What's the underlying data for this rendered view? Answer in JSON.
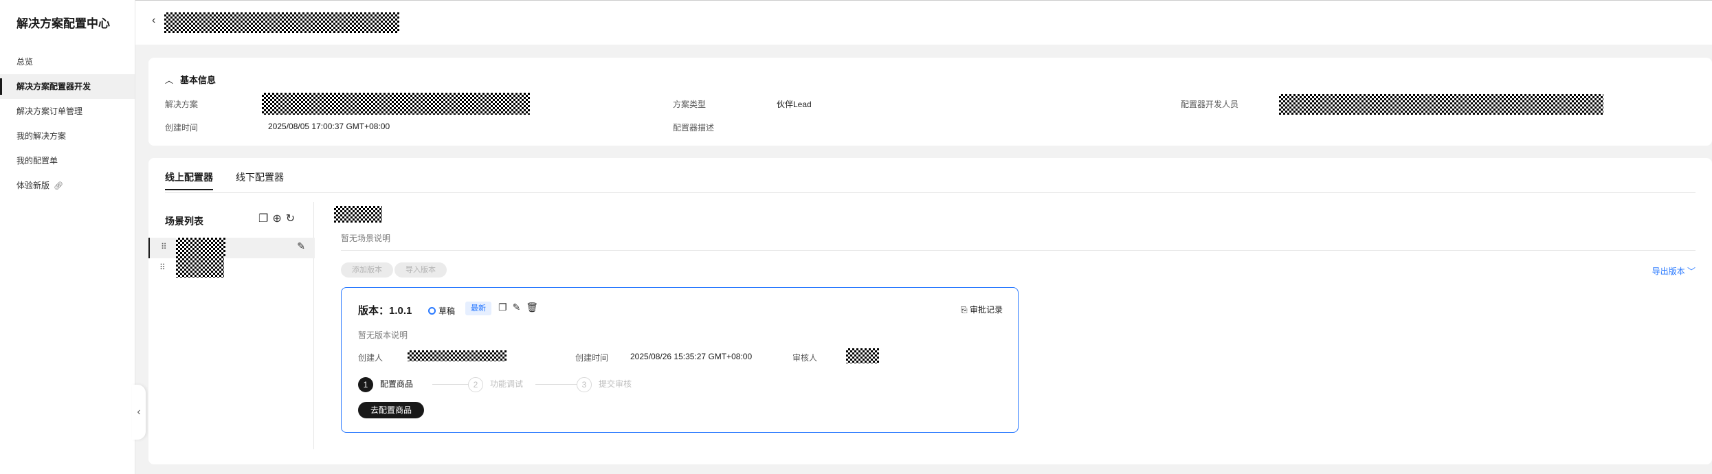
{
  "sidebar": {
    "brand": "解决方案配置中心",
    "items": [
      {
        "label": "总览"
      },
      {
        "label": "解决方案配置器开发"
      },
      {
        "label": "解决方案订单管理"
      },
      {
        "label": "我的解决方案"
      },
      {
        "label": "我的配置单"
      },
      {
        "label": "体验新版"
      }
    ]
  },
  "basic_info": {
    "section_title": "基本信息",
    "solution_label": "解决方案",
    "type_label": "方案类型",
    "type_value": "伙伴Lead",
    "developer_label": "配置器开发人员",
    "created_label": "创建时间",
    "created_value": "2025/08/05 17:00:37 GMT+08:00",
    "desc_label": "配置器描述"
  },
  "tabs": [
    {
      "label": "线上配置器"
    },
    {
      "label": "线下配置器"
    }
  ],
  "scene": {
    "list_title": "场景列表",
    "description": "暂无场景说明",
    "add_version": "添加版本",
    "import_version": "导入版本",
    "export_version": "导出版本"
  },
  "version": {
    "title": "版本：1.0.1",
    "status": "草稿",
    "badge": "最新",
    "approval_record": "审批记录",
    "description": "暂无版本说明",
    "creator_label": "创建人",
    "created_label": "创建时间",
    "created_value": "2025/08/26 15:35:27 GMT+08:00",
    "reviewer_label": "审核人",
    "steps": [
      {
        "num": "1",
        "label": "配置商品"
      },
      {
        "num": "2",
        "label": "功能调试"
      },
      {
        "num": "3",
        "label": "提交审核"
      }
    ],
    "go_button": "去配置商品"
  },
  "colors": {
    "accent": "#2979ff",
    "primary": "#191919"
  }
}
